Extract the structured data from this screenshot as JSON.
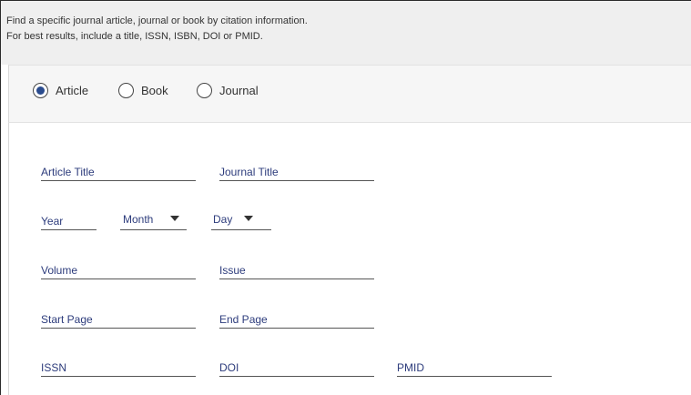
{
  "intro": {
    "line1": "Find a specific journal article, journal or book by citation information.",
    "line2": "For best results, include a title, ISSN, ISBN, DOI or PMID."
  },
  "type_options": [
    {
      "label": "Article",
      "selected": true
    },
    {
      "label": "Book",
      "selected": false
    },
    {
      "label": "Journal",
      "selected": false
    }
  ],
  "fields": {
    "article_title": "Article Title",
    "journal_title": "Journal Title",
    "year": "Year",
    "month": "Month",
    "day": "Day",
    "volume": "Volume",
    "issue": "Issue",
    "start_page": "Start Page",
    "end_page": "End Page",
    "issn": "ISSN",
    "doi": "DOI",
    "pmid": "PMID"
  },
  "colors": {
    "accent": "#2a4b8d",
    "field_label": "#2d3c7c",
    "intro_background": "#efefef",
    "type_bar_background": "#f6f6f6"
  }
}
